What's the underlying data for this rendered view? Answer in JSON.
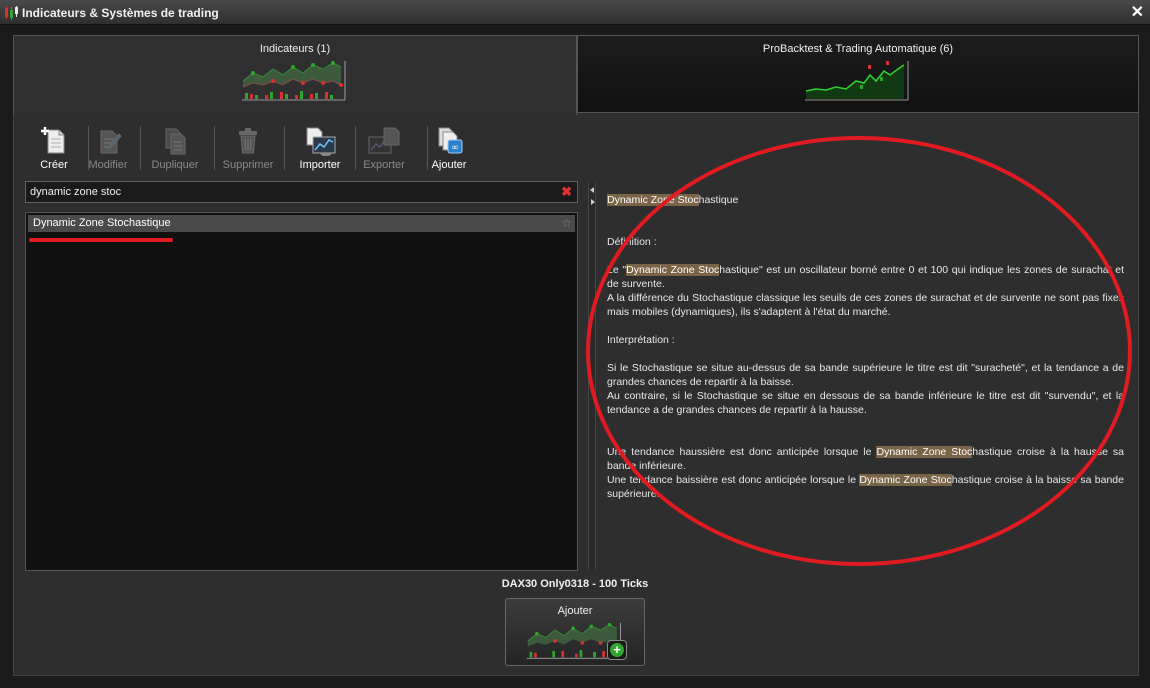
{
  "window": {
    "title": "Indicateurs & Systèmes de trading",
    "close_glyph": "✕"
  },
  "tabs": [
    {
      "label": "Indicateurs (1)",
      "active": true
    },
    {
      "label": "ProBacktest & Trading Automatique (6)",
      "active": false
    }
  ],
  "toolbar": [
    {
      "label": "Créer",
      "icon": "new-document-icon",
      "enabled": true
    },
    {
      "label": "Modifier",
      "icon": "edit-document-icon",
      "enabled": false
    },
    {
      "label": "Dupliquer",
      "icon": "duplicate-icon",
      "enabled": false
    },
    {
      "label": "Supprimer",
      "icon": "trash-icon",
      "enabled": false
    },
    {
      "label": "Importer",
      "icon": "import-icon",
      "enabled": true
    },
    {
      "label": "Exporter",
      "icon": "export-icon",
      "enabled": false
    },
    {
      "label": "Ajouter",
      "icon": "add-icon",
      "enabled": true
    }
  ],
  "search": {
    "value": "dynamic zone stoc",
    "clear_glyph": "✖"
  },
  "list": {
    "items": [
      {
        "label": "Dynamic Zone Stochastique",
        "star": "☆"
      }
    ]
  },
  "description": {
    "l1_hl": "Dynamic Zone Stoc",
    "l1_rest": "hastique",
    "definition": "Définition :",
    "p1_a": "Le \"",
    "p1_hl": "Dynamic Zone Stoc",
    "p1_b": "hastique\" est un oscillateur borné entre 0 et 100 qui indique les zones de surachat et de survente.",
    "p2": "A la différence du Stochastique classique les seuils de ces zones de surachat et de survente ne sont pas fixes mais mobiles (dynamiques), ils s'adaptent à l'état du marché.",
    "interpretation": "Interprétation :",
    "p3": "Si le Stochastique se situe au-dessus de sa bande supérieure le titre est dit \"suracheté\", et la tendance a de grandes chances de repartir à la baisse.",
    "p4": "Au contraire, si le Stochastique se situe en dessous de sa bande inférieure le titre est dit \"survendu\", et la tendance a de grandes chances de repartir à la hausse.",
    "p5_a": "Une tendance haussière est donc anticipée lorsque le ",
    "p5_hl": "Dynamic Zone Stoc",
    "p5_b": "hastique croise à la hausse sa bande inférieure.",
    "p6_a": "Une tendance baissière est donc anticipée lorsque le ",
    "p6_hl": "Dynamic Zone Stoc",
    "p6_b": "hastique croise à la baisse sa bande supérieure."
  },
  "footer": {
    "instrument": "DAX30 Only0318 - 100 Ticks",
    "add_label": "Ajouter",
    "plus_glyph": "+"
  },
  "colors": {
    "annotation_red": "#e01b22",
    "highlight": "#7a6448",
    "chart_green": "#2fa52f",
    "chart_red": "#d93030"
  }
}
